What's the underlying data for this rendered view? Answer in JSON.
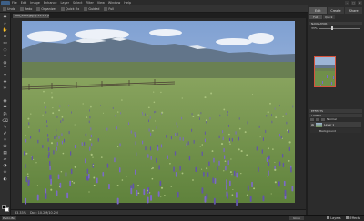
{
  "menubar": {
    "items": [
      "File",
      "Edit",
      "Image",
      "Enhance",
      "Layer",
      "Select",
      "Filter",
      "View",
      "Window",
      "Help"
    ],
    "window_controls": [
      "–",
      "□",
      "×"
    ]
  },
  "options": {
    "tools": [
      "Undo",
      "Redo",
      "Organizer",
      "Quick Fix",
      "Guided",
      "Full"
    ],
    "right": [
      "Create",
      "Share"
    ]
  },
  "document": {
    "tab_title": "IMG_1234.jpg @ 33.3% (RGB/8)",
    "status": [
      "33.33%",
      "Doc: 10.2M/10.2M"
    ]
  },
  "bottombar": {
    "photo_bin": "Photo Bin",
    "undo_history": "Undo History",
    "right": [
      "Layers",
      "Effects"
    ]
  },
  "panel": {
    "mode_tabs": [
      "Edit",
      "Create",
      "Share"
    ],
    "sub_tabs": [
      "Full",
      "Quick"
    ],
    "navigator_title": "NAVIGATOR",
    "zoom_value": "33%",
    "effects_title": "EFFECTS",
    "layers_title": "LAYERS",
    "blend_mode": "Normal",
    "layer_name": "Layer 1",
    "background_name": "Background"
  },
  "colors": {
    "accent": "#4a7fb5",
    "nav_frame": "#d6533d",
    "sky": "#9db5d6",
    "meadow": "#6f8f4a",
    "lupine": "#7c6ac8"
  },
  "tool_icons": [
    "move-icon",
    "zoom-icon",
    "hand-icon",
    "eyedropper-icon",
    "marquee-icon",
    "lasso-icon",
    "magic-wand-icon",
    "quick-select-icon",
    "text-icon",
    "crop-icon",
    "recompose-icon",
    "cookie-cutter-icon",
    "straighten-icon",
    "red-eye-icon",
    "spot-healing-icon",
    "clone-stamp-icon",
    "eraser-icon",
    "pencil-icon",
    "brush-icon",
    "smart-brush-icon",
    "paint-bucket-icon",
    "gradient-icon",
    "shape-icon",
    "blur-icon",
    "sponge-icon",
    "dodge-icon"
  ]
}
